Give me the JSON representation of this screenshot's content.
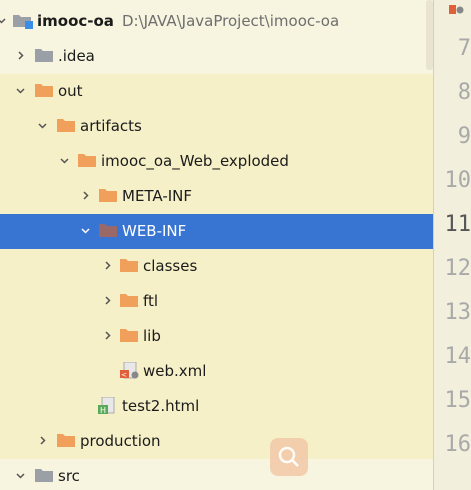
{
  "project": {
    "name": "imooc-oa",
    "path": "D:\\JAVA\\JavaProject\\imooc-oa"
  },
  "tree": [
    {
      "label": "imooc-oa",
      "expanded": true,
      "type": "project"
    },
    {
      "label": ".idea",
      "expanded": false,
      "type": "folder-gray"
    },
    {
      "label": "out",
      "expanded": true,
      "type": "folder-orange"
    },
    {
      "label": "artifacts",
      "expanded": true,
      "type": "folder-orange"
    },
    {
      "label": "imooc_oa_Web_exploded",
      "expanded": true,
      "type": "folder-orange"
    },
    {
      "label": "META-INF",
      "expanded": false,
      "type": "folder-orange"
    },
    {
      "label": "WEB-INF",
      "expanded": true,
      "type": "folder-orange",
      "selected": true
    },
    {
      "label": "classes",
      "expanded": false,
      "type": "folder-orange"
    },
    {
      "label": "ftl",
      "expanded": false,
      "type": "folder-orange"
    },
    {
      "label": "lib",
      "expanded": false,
      "type": "folder-orange"
    },
    {
      "label": "web.xml",
      "type": "xml-file"
    },
    {
      "label": "test2.html",
      "type": "html-file"
    },
    {
      "label": "production",
      "expanded": false,
      "type": "folder-orange"
    },
    {
      "label": "src",
      "expanded": true,
      "type": "folder-gray"
    }
  ],
  "line_numbers": [
    "7",
    "8",
    "9",
    "10",
    "11",
    "12",
    "13",
    "14",
    "15",
    "16"
  ],
  "current_line": "11",
  "colors": {
    "selection": "#3874d1",
    "folder_orange": "#f0a05a",
    "folder_gray": "#9aa0a6",
    "background": "#f7f4e0"
  },
  "icons": {
    "search": "search-icon"
  }
}
